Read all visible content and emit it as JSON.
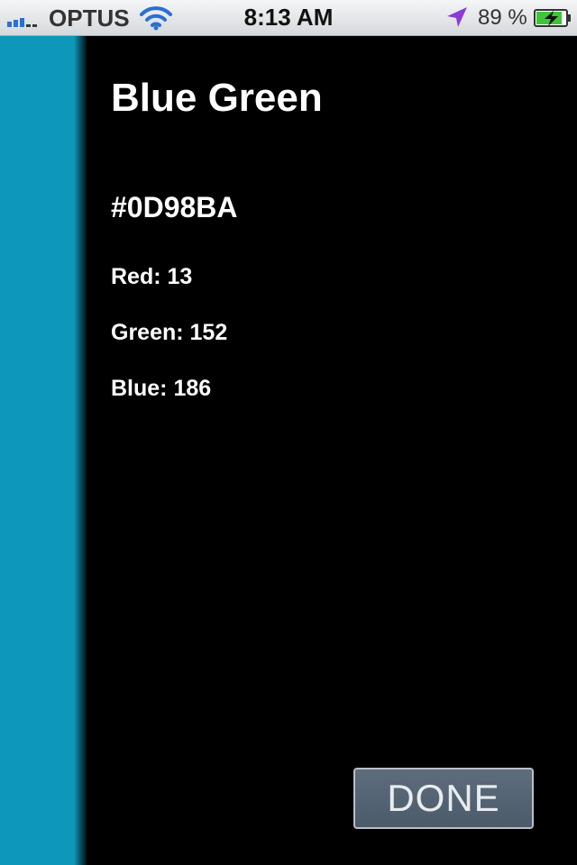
{
  "status_bar": {
    "carrier": "OPTUS",
    "time": "8:13 AM",
    "battery_percent": "89 %",
    "signal_bars_filled": 3,
    "signal_bars_total": 5,
    "battery_level": 0.89,
    "icons": [
      "signal-icon",
      "wifi-icon",
      "location-arrow-icon",
      "battery-charging-icon"
    ]
  },
  "color": {
    "name": "Blue Green",
    "hex": "#0D98BA",
    "swatch_color": "#0d98ba",
    "red_label": "Red: 13",
    "green_label": "Green: 152",
    "blue_label": "Blue: 186"
  },
  "actions": {
    "done_label": "DONE"
  }
}
